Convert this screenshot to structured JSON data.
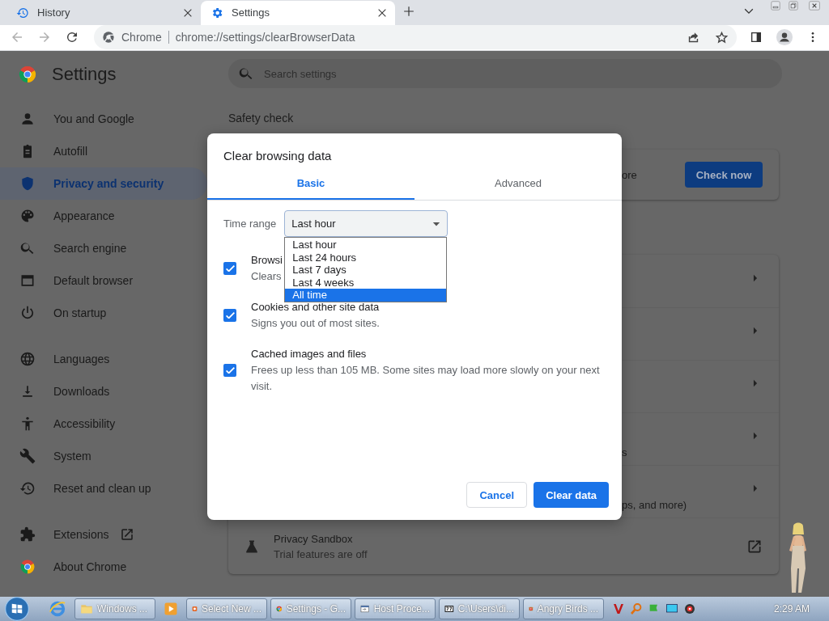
{
  "browser": {
    "tabs": [
      {
        "title": "History",
        "selected": false
      },
      {
        "title": "Settings",
        "selected": true
      }
    ],
    "address": {
      "origin": "Chrome",
      "url": "chrome://settings/clearBrowserData"
    }
  },
  "settings": {
    "title": "Settings",
    "search": {
      "placeholder": "Search settings"
    },
    "nav": [
      [
        {
          "label": "You and Google",
          "selected": false
        },
        {
          "label": "Autofill",
          "selected": false
        },
        {
          "label": "Privacy and security",
          "selected": true
        },
        {
          "label": "Appearance",
          "selected": false
        },
        {
          "label": "Search engine",
          "selected": false
        },
        {
          "label": "Default browser",
          "selected": false
        },
        {
          "label": "On startup",
          "selected": false
        }
      ],
      [
        {
          "label": "Languages",
          "selected": false
        },
        {
          "label": "Downloads",
          "selected": false
        },
        {
          "label": "Accessibility",
          "selected": false
        },
        {
          "label": "System",
          "selected": false
        },
        {
          "label": "Reset and clean up",
          "selected": false
        }
      ],
      [
        {
          "label": "Extensions",
          "selected": false
        },
        {
          "label": "About Chrome",
          "selected": false
        }
      ]
    ],
    "safety_check": {
      "heading": "Safety check",
      "text": "ore",
      "button": "Check now"
    },
    "privacy_rows": [
      {},
      {},
      {},
      {
        "text": "s"
      },
      {
        "text": "ps, and more)"
      }
    ],
    "sandbox": {
      "title": "Privacy Sandbox",
      "subtitle": "Trial features are off"
    }
  },
  "dialog": {
    "title": "Clear browsing data",
    "tabs": [
      {
        "label": "Basic",
        "selected": true
      },
      {
        "label": "Advanced",
        "selected": false
      }
    ],
    "time_range": {
      "label": "Time range",
      "value": "Last hour",
      "expanded": true,
      "options": [
        {
          "label": "Last hour",
          "highlighted": false
        },
        {
          "label": "Last 24 hours",
          "highlighted": false
        },
        {
          "label": "Last 7 days",
          "highlighted": false
        },
        {
          "label": "Last 4 weeks",
          "highlighted": false
        },
        {
          "label": "All time",
          "highlighted": true
        }
      ]
    },
    "items": [
      {
        "title": "Browsi",
        "description": "Clears",
        "checked": true
      },
      {
        "title": "Cookies and other site data",
        "description": "Signs you out of most sites.",
        "checked": true
      },
      {
        "title": "Cached images and files",
        "description": "Frees up less than 105 MB. Some sites may load more slowly on your next visit.",
        "checked": true
      }
    ],
    "buttons": [
      {
        "label": "Cancel",
        "kind": "secondary"
      },
      {
        "label": "Clear data",
        "kind": "primary"
      }
    ]
  },
  "taskbar": {
    "tasks": [
      {
        "label": "Windows ..."
      },
      {
        "label": "Select New ..."
      },
      {
        "label": "Settings - G..."
      },
      {
        "label": "Host Proce..."
      },
      {
        "label": "C:\\Users\\di..."
      },
      {
        "label": "Angry Birds ..."
      }
    ],
    "clock": "2:29 AM"
  }
}
